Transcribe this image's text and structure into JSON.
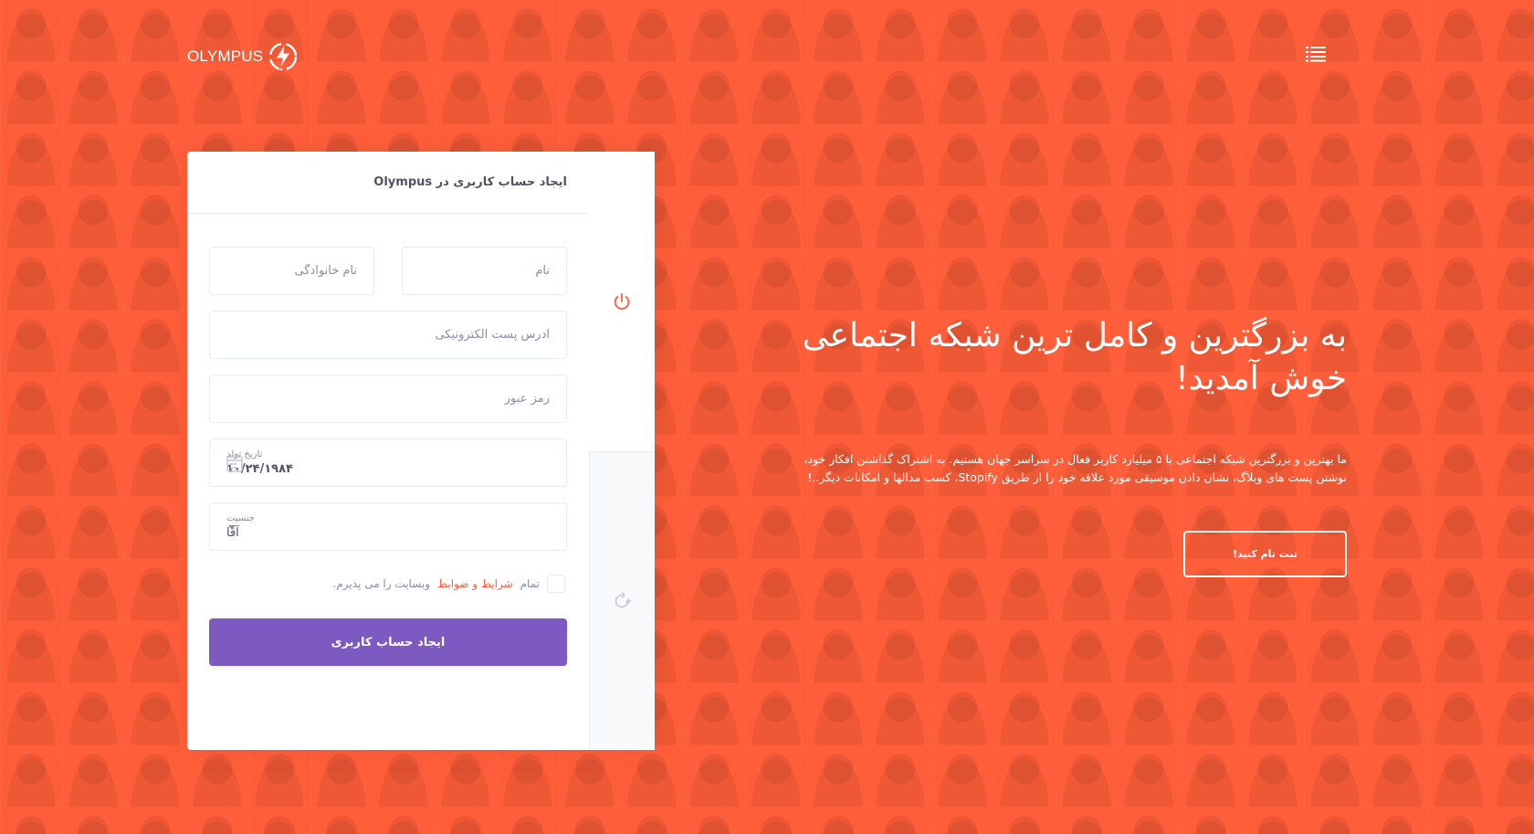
{
  "header": {
    "logo_text": "OLYMPUS",
    "logo_icon": "lightning-bolt-icon",
    "menu_icon": "menu-icon"
  },
  "form": {
    "title": "ایجاد حساب کاربری در Olympus",
    "first_name_placeholder": "نام",
    "last_name_placeholder": "نام خانوادگی",
    "email_placeholder": "آدرس پست الکترونیکی",
    "password_placeholder": "رمز عبور",
    "birthday_label": "تاریخ تولد",
    "birthday_value": "۱۰/۲۴/۱۹۸۴",
    "gender_label": "جنسیت",
    "gender_value": "آقا",
    "terms_prefix": "تمام",
    "terms_link": "شرایط و ضوابط",
    "terms_suffix": "وبسایت را می پذیرم.",
    "submit_label": "ایجاد حساب کاربری"
  },
  "tabs": {
    "tab_1_icon": "power-icon",
    "tab_2_icon": "refresh-add-icon"
  },
  "hero": {
    "title_line_1": "به بزرگترین و کامل ترین شبکه اجتماعی",
    "title_line_2": "خوش آمدید!",
    "text_line_1": "ما بهترین و بزرگترین شبکه اجتماعی با ۵ میلیارد کاربر فعال در سراسر جهان هستیم. به اشتراک گذاشتن افکار خود،",
    "text_line_2": "نوشتن پست های وبلاگ، نشان دادن موسیقی مورد علاقه خود را از طریق Stopify، کسب مدالها و امکانات دیگر..!",
    "button_label": "ثبت نام کنید!"
  },
  "colors": {
    "background": "#ff5e3a",
    "accent": "#ff5e3a",
    "button": "#7c5ac2"
  }
}
